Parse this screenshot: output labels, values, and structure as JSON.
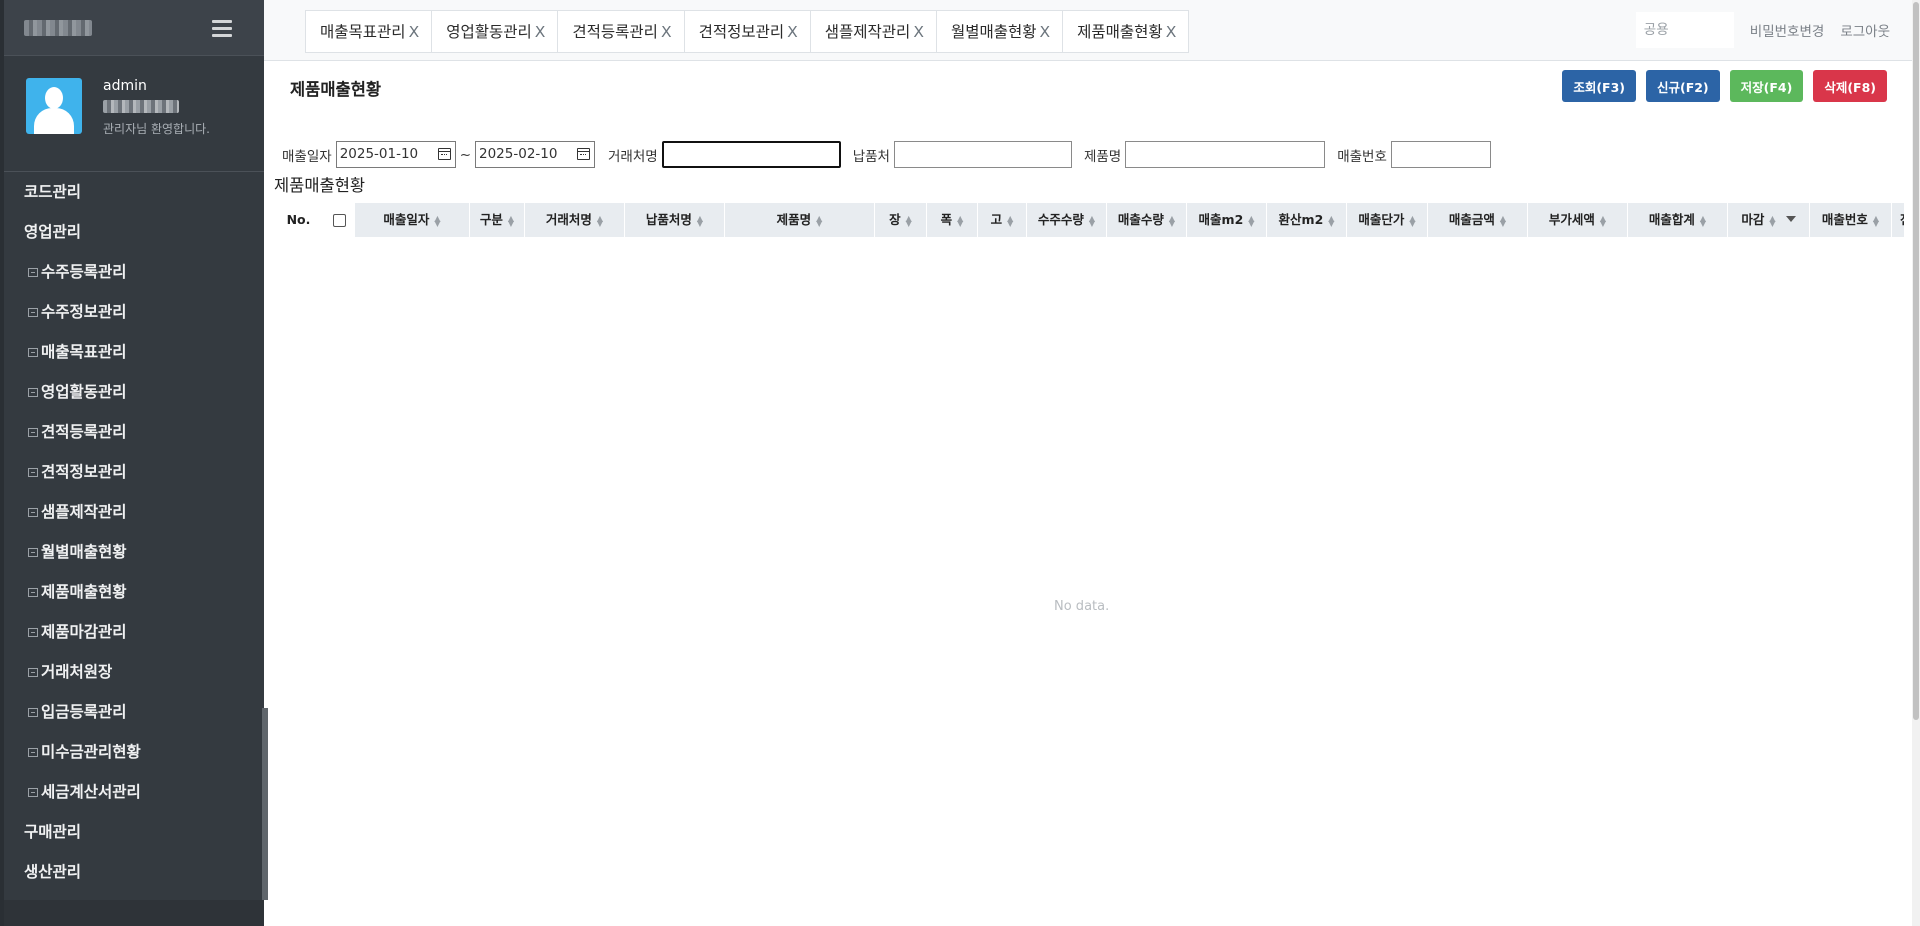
{
  "sidebar": {
    "user_name": "admin",
    "user_welcome": "관리자님 환영합니다.",
    "menu": [
      {
        "label": "코드관리",
        "sub": false
      },
      {
        "label": "영업관리",
        "sub": false
      },
      {
        "label": "수주등록관리",
        "sub": true
      },
      {
        "label": "수주정보관리",
        "sub": true
      },
      {
        "label": "매출목표관리",
        "sub": true
      },
      {
        "label": "영업활동관리",
        "sub": true
      },
      {
        "label": "견적등록관리",
        "sub": true
      },
      {
        "label": "견적정보관리",
        "sub": true
      },
      {
        "label": "샘플제작관리",
        "sub": true
      },
      {
        "label": "월별매출현황",
        "sub": true
      },
      {
        "label": "제품매출현황",
        "sub": true
      },
      {
        "label": "제품마감관리",
        "sub": true
      },
      {
        "label": "거래처원장",
        "sub": true
      },
      {
        "label": "입금등록관리",
        "sub": true
      },
      {
        "label": "미수금관리현황",
        "sub": true
      },
      {
        "label": "세금계산서관리",
        "sub": true
      },
      {
        "label": "구매관리",
        "sub": false
      },
      {
        "label": "생산관리",
        "sub": false
      }
    ]
  },
  "tabs": [
    {
      "label": "매출목표관리",
      "close": "X"
    },
    {
      "label": "영업활동관리",
      "close": "X"
    },
    {
      "label": "견적등록관리",
      "close": "X"
    },
    {
      "label": "견적정보관리",
      "close": "X"
    },
    {
      "label": "샘플제작관리",
      "close": "X"
    },
    {
      "label": "월별매출현황",
      "close": "X"
    },
    {
      "label": "제품매출현황",
      "close": "X"
    }
  ],
  "header": {
    "search_placeholder": "공용",
    "change_password": "비밀번호변경",
    "logout": "로그아웃"
  },
  "page": {
    "title": "제품매출현황",
    "grid_title": "제품매출현황",
    "buttons": {
      "search": "조회(F3)",
      "new": "신규(F2)",
      "save": "저장(F4)",
      "delete": "삭제(F8)"
    },
    "colors": {
      "primary": "#2c64a6",
      "success": "#5cb85c",
      "danger": "#d9364a",
      "sidebar": "#343a40"
    }
  },
  "filters": {
    "sales_date_label": "매출일자",
    "date_from": "2025-01-10",
    "date_sep": "~",
    "date_to": "2025-02-10",
    "client_label": "거래처명",
    "client_value": "",
    "delivery_label": "납품처",
    "delivery_value": "",
    "product_label": "제품명",
    "product_value": "",
    "sales_no_label": "매출번호",
    "sales_no_value": ""
  },
  "grid": {
    "columns": [
      {
        "label": "No."
      },
      {
        "label": ""
      },
      {
        "label": "매출일자"
      },
      {
        "label": "구분"
      },
      {
        "label": "거래처명"
      },
      {
        "label": "납품처명"
      },
      {
        "label": "제품명"
      },
      {
        "label": "장"
      },
      {
        "label": "폭"
      },
      {
        "label": "고"
      },
      {
        "label": "수주수량"
      },
      {
        "label": "매출수량"
      },
      {
        "label": "매출m2"
      },
      {
        "label": "환산m2"
      },
      {
        "label": "매출단가"
      },
      {
        "label": "매출금액"
      },
      {
        "label": "부가세액"
      },
      {
        "label": "매출합계"
      },
      {
        "label": "마감"
      },
      {
        "label": "매출번호"
      },
      {
        "label": "전표"
      }
    ],
    "empty_text": "No data."
  }
}
